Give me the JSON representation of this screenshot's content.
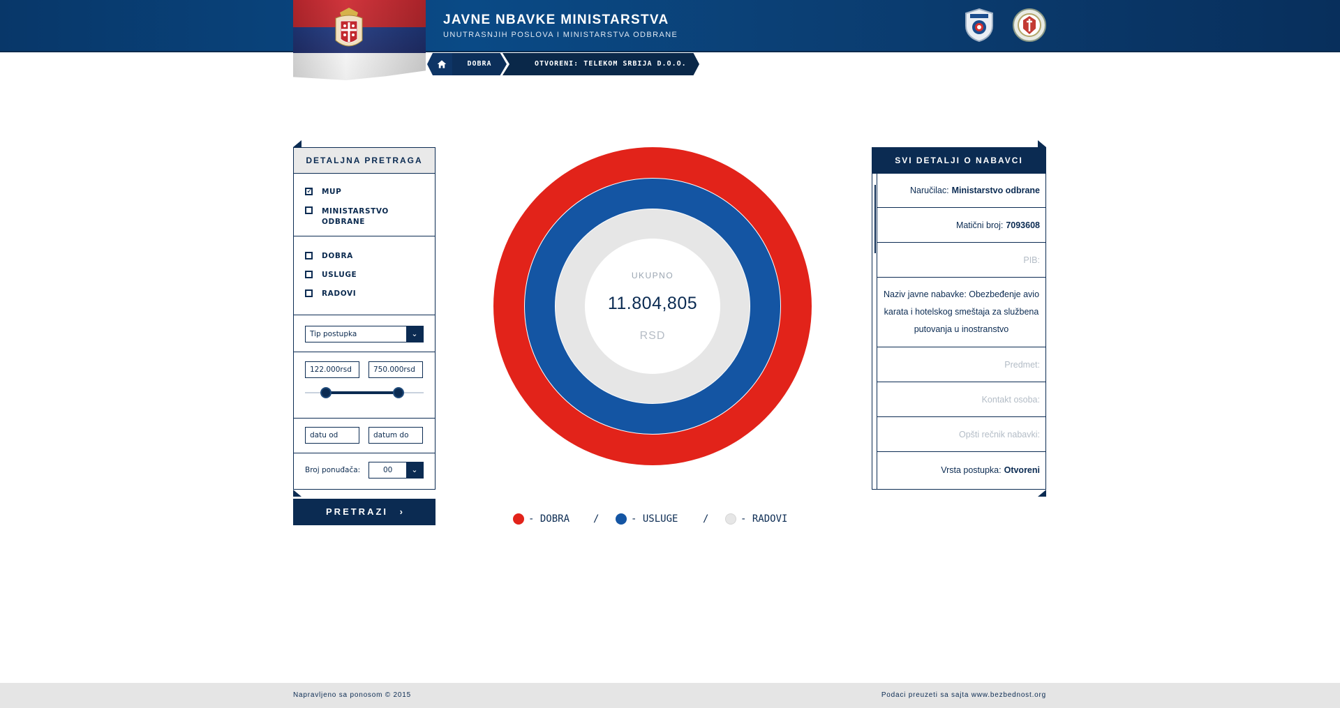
{
  "header": {
    "title": "JAVNE NBAVKE MINISTARSTVA",
    "subtitle": "UNUTRASNJIH POSLOVA I MINISTARSTVA ODBRANE",
    "badges": [
      "police-badge-icon",
      "army-badge-icon"
    ]
  },
  "breadcrumb": {
    "home_icon": "home-icon",
    "items": [
      "DOBRA",
      "OTVORENI: TELEKOM SRBIJA D.O.O."
    ]
  },
  "filters": {
    "title": "DETALJNA PRETRAGA",
    "ministries": [
      {
        "label": "MUP",
        "checked": true
      },
      {
        "label": "MINISTARSTVO ODBRANE",
        "checked": false
      }
    ],
    "categories": [
      {
        "label": "DOBRA",
        "checked": false
      },
      {
        "label": "USLUGE",
        "checked": false
      },
      {
        "label": "RADOVI",
        "checked": false
      }
    ],
    "procedure_type": "Tip postupka",
    "price_min": "122.000rsd",
    "price_max": "750.000rsd",
    "date_from": "datu od",
    "date_to": "datum do",
    "bidders_label": "Broj ponuđača:",
    "bidders_value": "00",
    "search_button": "PRETRAZI"
  },
  "summary": {
    "label": "UKUPNO",
    "value": "11.804,805",
    "currency": "RSD",
    "legend": [
      {
        "prefix": "-",
        "label": "DOBRA",
        "color": "#e2231a"
      },
      {
        "prefix": "-",
        "label": "USLUGE",
        "color": "#1455a3"
      },
      {
        "prefix": "-",
        "label": "RADOVI",
        "color": "#e6e6e6"
      }
    ],
    "separator": "/"
  },
  "details": {
    "title": "SVI DETALJI O NABAVCI",
    "rows": [
      {
        "label": "Naručilac:",
        "value": "Ministarstvo odbrane"
      },
      {
        "label": "Matični broj:",
        "value": "7093608"
      },
      {
        "label": "PIB:",
        "value": ""
      },
      {
        "label": "Naziv javne nabavke: Obezbeđenje avio karata i hotelskog smeštaja za službena putovanja u inostranstvo",
        "value": ""
      },
      {
        "label": "Predmet:",
        "value": ""
      },
      {
        "label": "Kontakt osoba:",
        "value": ""
      },
      {
        "label": "Opšti rečnik nabavki:",
        "value": ""
      },
      {
        "label": "Vrsta postupka:",
        "value": "Otvoreni"
      }
    ]
  },
  "footer": {
    "left": "Napravljeno sa ponosom © 2015",
    "right": "Podaci preuzeti sa sajta www.bezbednost.org"
  },
  "colors": {
    "navy": "#0b2b52",
    "red": "#e2231a",
    "blue": "#1455a3",
    "grey": "#e6e6e6"
  }
}
